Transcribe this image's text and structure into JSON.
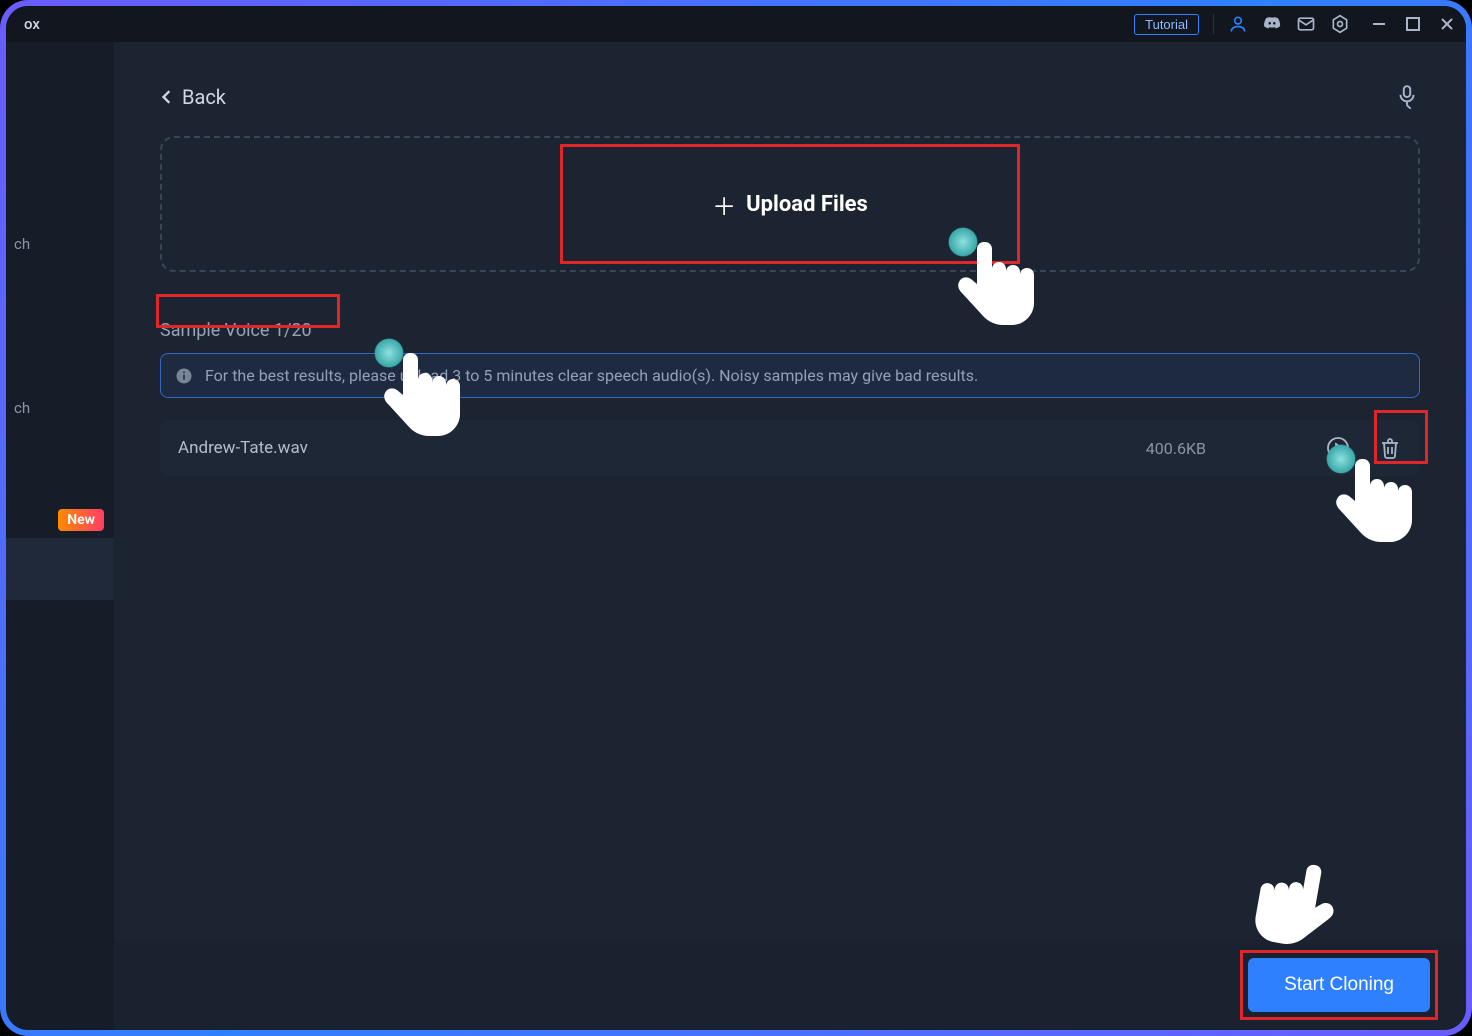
{
  "titlebar": {
    "app_title": "ox",
    "tutorial_label": "Tutorial"
  },
  "sidebar": {
    "item1": "ch",
    "item2": "ch",
    "new_badge": "New"
  },
  "back": {
    "label": "Back"
  },
  "upload": {
    "label": "Upload Files"
  },
  "sample_voice": {
    "label": "Sample Voice 1/20"
  },
  "info": {
    "text": "For the best results, please upload 3 to 5 minutes clear speech audio(s). Noisy samples may give bad results."
  },
  "files": {
    "items": [
      {
        "name": "Andrew-Tate.wav",
        "size": "400.6KB"
      }
    ]
  },
  "cta": {
    "start_label": "Start Cloning"
  }
}
